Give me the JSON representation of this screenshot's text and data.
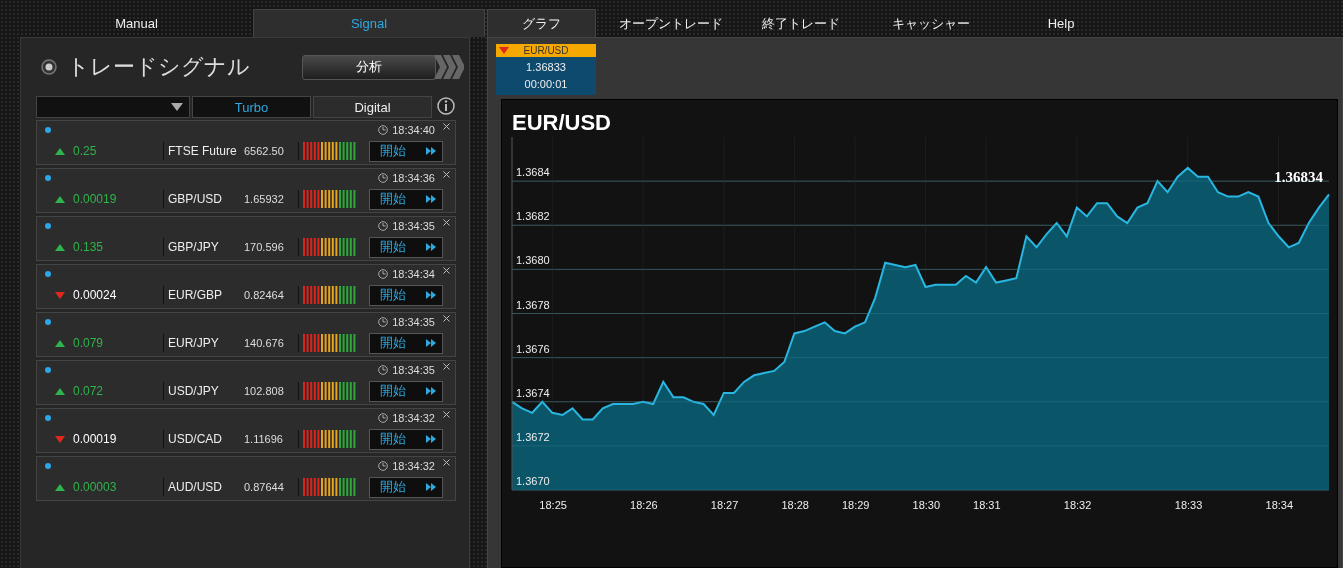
{
  "left_tabs": [
    {
      "label": "Manual",
      "selected": false
    },
    {
      "label": "Signal",
      "selected": true
    }
  ],
  "right_tabs": [
    {
      "label": "グラフ",
      "selected": true
    },
    {
      "label": "オープントレード",
      "selected": false
    },
    {
      "label": "終了トレード",
      "selected": false
    },
    {
      "label": "キャッシャー",
      "selected": false
    },
    {
      "label": "Help",
      "selected": false
    }
  ],
  "signal_panel": {
    "title": "トレードシグナル",
    "analyze_button": "分析",
    "filter_tabs": [
      {
        "label": "Turbo",
        "selected": true
      },
      {
        "label": "Digital",
        "selected": false
      }
    ],
    "rows": [
      {
        "rising": true,
        "change": "0.25",
        "asset": "FTSE Future",
        "price": "6562.50",
        "time": "18:34:40",
        "button": "開始"
      },
      {
        "rising": true,
        "change": "0.00019",
        "asset": "GBP/USD",
        "price": "1.65932",
        "time": "18:34:36",
        "button": "開始"
      },
      {
        "rising": true,
        "change": "0.135",
        "asset": "GBP/JPY",
        "price": "170.596",
        "time": "18:34:35",
        "button": "開始"
      },
      {
        "rising": false,
        "change": "0.00024",
        "asset": "EUR/GBP",
        "price": "0.82464",
        "time": "18:34:34",
        "button": "開始"
      },
      {
        "rising": true,
        "change": "0.079",
        "asset": "EUR/JPY",
        "price": "140.676",
        "time": "18:34:35",
        "button": "開始"
      },
      {
        "rising": true,
        "change": "0.072",
        "asset": "USD/JPY",
        "price": "102.808",
        "time": "18:34:35",
        "button": "開始"
      },
      {
        "rising": false,
        "change": "0.00019",
        "asset": "USD/CAD",
        "price": "1.11696",
        "time": "18:34:32",
        "button": "開始"
      },
      {
        "rising": true,
        "change": "0.00003",
        "asset": "AUD/USD",
        "price": "0.87644",
        "time": "18:34:32",
        "button": "開始"
      }
    ]
  },
  "ticker": {
    "rising": false,
    "asset": "EUR/USD",
    "price": "1.36833",
    "timer": "00:00:01"
  },
  "chart_panel": {
    "chart_data": {
      "type": "area",
      "title": "EUR/USD",
      "categories": [
        null,
        null,
        null,
        null,
        "18:25",
        null,
        null,
        null,
        null,
        null,
        null,
        null,
        null,
        "18:26",
        null,
        null,
        null,
        null,
        null,
        null,
        null,
        "18:27",
        null,
        null,
        null,
        null,
        null,
        null,
        "18:28",
        null,
        null,
        null,
        null,
        null,
        "18:29",
        null,
        null,
        null,
        null,
        null,
        null,
        "18:30",
        null,
        null,
        null,
        null,
        null,
        "18:31",
        null,
        null,
        null,
        null,
        null,
        null,
        null,
        null,
        "18:32",
        null,
        null,
        null,
        null,
        null,
        null,
        null,
        null,
        null,
        null,
        "18:33",
        null,
        null,
        null,
        null,
        null,
        null,
        null,
        null,
        "18:34",
        null,
        null,
        null,
        null,
        null
      ],
      "series": [
        {
          "color": "#29b6e0",
          "values": [
            1.3674,
            1.36737,
            1.36735,
            1.3674,
            1.36735,
            1.36734,
            1.36737,
            1.36732,
            1.36732,
            1.36737,
            1.36739,
            1.36739,
            1.36739,
            1.3674,
            1.36739,
            1.36749,
            1.36742,
            1.36742,
            1.3674,
            1.36739,
            1.36734,
            1.36744,
            1.36744,
            1.36749,
            1.36752,
            1.36753,
            1.36754,
            1.36758,
            1.36771,
            1.36772,
            1.36774,
            1.36776,
            1.36772,
            1.36771,
            1.36774,
            1.36776,
            1.36787,
            1.36803,
            1.36802,
            1.36801,
            1.36802,
            1.36792,
            1.36793,
            1.36793,
            1.36793,
            1.36797,
            1.36794,
            1.36801,
            1.36794,
            1.36795,
            1.36796,
            1.36815,
            1.3681,
            1.36816,
            1.36821,
            1.36815,
            1.36828,
            1.36824,
            1.3683,
            1.3683,
            1.36824,
            1.36821,
            1.36828,
            1.3683,
            1.3684,
            1.36835,
            1.36842,
            1.36846,
            1.36842,
            1.36842,
            1.36835,
            1.36833,
            1.36833,
            1.36835,
            1.36833,
            1.36821,
            1.36815,
            1.3681,
            1.36812,
            1.36821,
            1.36828,
            1.36834
          ]
        }
      ],
      "ylim": [
        1.367,
        1.3686
      ],
      "yticks": [
        {
          "value": 1.367,
          "label": "1.3670"
        },
        {
          "value": 1.3672,
          "label": "1.3672"
        },
        {
          "value": 1.3674,
          "label": "1.3674"
        },
        {
          "value": 1.3676,
          "label": "1.3676"
        },
        {
          "value": 1.3678,
          "label": "1.3678"
        },
        {
          "value": 1.368,
          "label": "1.3680"
        },
        {
          "value": 1.3682,
          "label": "1.3682"
        },
        {
          "value": 1.3684,
          "label": "1.3684"
        }
      ],
      "grid": true,
      "annotations": [
        "1.36834"
      ]
    }
  }
}
